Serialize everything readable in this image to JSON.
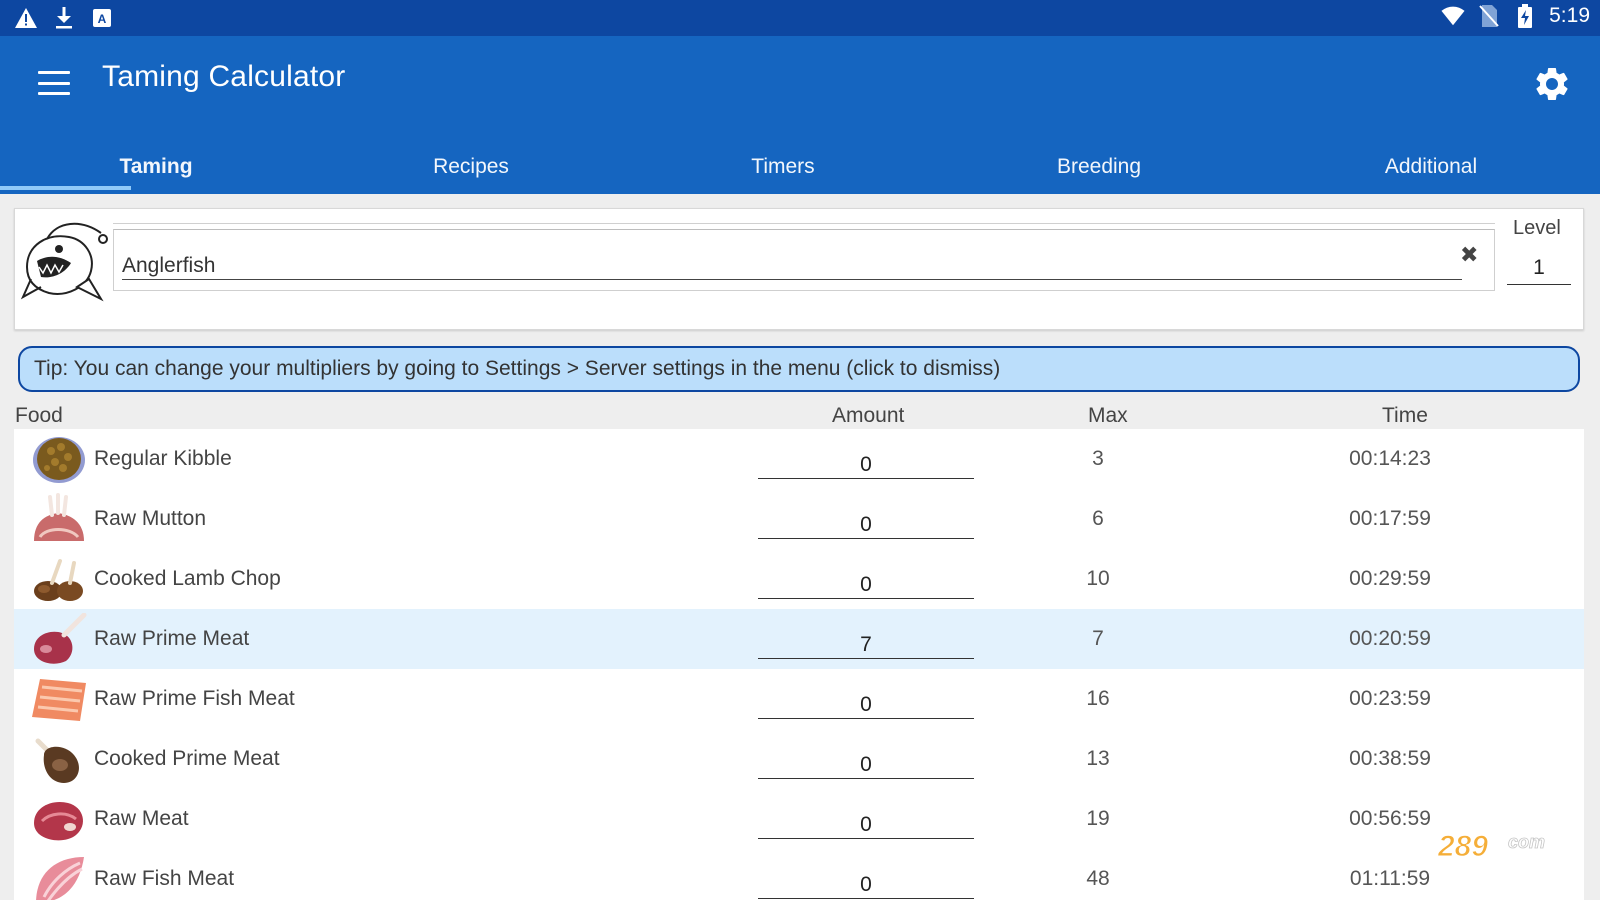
{
  "status_bar": {
    "time": "5:19",
    "left_icons": [
      "warning-icon",
      "download-icon",
      "app-a-icon"
    ],
    "right_icons": [
      "wifi-icon",
      "no-sim-icon",
      "battery-charging-icon"
    ]
  },
  "app_bar": {
    "title": "Taming Calculator",
    "icons": [
      "menu-icon",
      "gear-icon"
    ]
  },
  "tabs": [
    {
      "label": "Taming",
      "active": true
    },
    {
      "label": "Recipes",
      "active": false
    },
    {
      "label": "Timers",
      "active": false
    },
    {
      "label": "Breeding",
      "active": false
    },
    {
      "label": "Additional",
      "active": false
    }
  ],
  "creature": {
    "name": "Anglerfish",
    "image": "anglerfish-icon",
    "level_label": "Level",
    "level": "1"
  },
  "tip": "Tip: You can change your multipliers by going to Settings > Server settings in the menu (click to dismiss)",
  "table": {
    "headers": {
      "food": "Food",
      "amount": "Amount",
      "max": "Max",
      "time": "Time"
    },
    "rows": [
      {
        "food": "Regular Kibble",
        "icon": "kibble-icon",
        "amount": "0",
        "max": "3",
        "time": "00:14:23",
        "selected": false
      },
      {
        "food": "Raw Mutton",
        "icon": "raw-mutton-icon",
        "amount": "0",
        "max": "6",
        "time": "00:17:59",
        "selected": false
      },
      {
        "food": "Cooked Lamb Chop",
        "icon": "cooked-lamb-chop-icon",
        "amount": "0",
        "max": "10",
        "time": "00:29:59",
        "selected": false
      },
      {
        "food": "Raw Prime Meat",
        "icon": "raw-prime-meat-icon",
        "amount": "7",
        "max": "7",
        "time": "00:20:59",
        "selected": true
      },
      {
        "food": "Raw Prime Fish Meat",
        "icon": "raw-prime-fish-meat-icon",
        "amount": "0",
        "max": "16",
        "time": "00:23:59",
        "selected": false
      },
      {
        "food": "Cooked Prime Meat",
        "icon": "cooked-prime-meat-icon",
        "amount": "0",
        "max": "13",
        "time": "00:38:59",
        "selected": false
      },
      {
        "food": "Raw Meat",
        "icon": "raw-meat-icon",
        "amount": "0",
        "max": "19",
        "time": "00:56:59",
        "selected": false
      },
      {
        "food": "Raw Fish Meat",
        "icon": "raw-fish-meat-icon",
        "amount": "0",
        "max": "48",
        "time": "01:11:59",
        "selected": false
      }
    ]
  },
  "watermark": "289 com",
  "colors": {
    "status_bar": "#0d47a1",
    "app_bar": "#1565c0",
    "tab_indicator": "#90caf9",
    "tip_background": "#bbdefb",
    "selected_row": "#e3f2fd"
  }
}
